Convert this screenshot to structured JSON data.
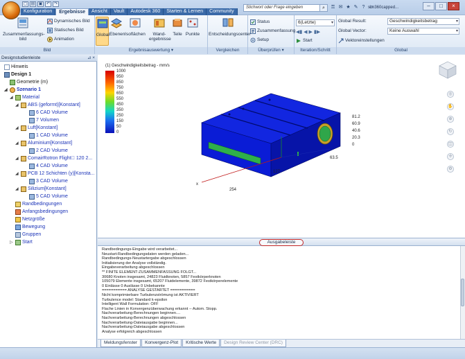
{
  "app": {
    "search_placeholder": "Stichwort oder Frage eingeben",
    "user_name": "sim360capped..."
  },
  "tabs": [
    "Konfiguration",
    "Ergebnisse",
    "Ansicht",
    "Vault",
    "Autodesk 360",
    "Starten & Lernen",
    "Community"
  ],
  "ribbon": {
    "bild": {
      "label": "Bild",
      "zusammenfassung": "Zusammenfassungs-bild",
      "dynamisch": "Dynamisches Bild",
      "statisch": "Statisches Bild",
      "animation": "Animation"
    },
    "auswertung": {
      "label": "Ergebnisauswertung",
      "global": "Global",
      "ebenen": "Ebenen",
      "isoflaechen": "Isoflächen",
      "wand": "Wand-ergebnisse",
      "teile": "Teile",
      "punkte": "Punkte"
    },
    "vergleichen": {
      "label": "Vergleichen",
      "entscheidung": "Entscheidungscenter"
    },
    "ueberpruefen": {
      "label": "Überprüfen",
      "status": "Status",
      "zusammenfassung": "Zusammenfassung",
      "setup": "Setup"
    },
    "iteration": {
      "label": "Iteration/Schritt",
      "value": "6(Letzte)",
      "start": "Start"
    },
    "global": {
      "label": "Global",
      "result_label": "Global Result:",
      "result_value": "Geschwindigkeitsbetrag",
      "vector_label": "Global Vector:",
      "vector_value": "Keine Auswahl",
      "vektor_settings": "Vektoreinstellungen"
    }
  },
  "left_panel": {
    "title": "Designstudienleiste",
    "items": [
      {
        "label": "Hinweis",
        "style": "normal"
      },
      {
        "label": "Design 1",
        "style": "bold"
      },
      {
        "label": "Geometrie (m)",
        "style": "normal"
      },
      {
        "label": "Szenario 1",
        "style": "bold-blue"
      },
      {
        "label": "Material",
        "style": "blue"
      },
      {
        "label": "ABS (geformt)[Konstant]",
        "style": "blue"
      },
      {
        "label": "6 CAD Volume",
        "style": "blue"
      },
      {
        "label": "7 Volumen",
        "style": "blue"
      },
      {
        "label": "Luft[Konstant]",
        "style": "blue"
      },
      {
        "label": "1 CAD Volume",
        "style": "blue"
      },
      {
        "label": "Aluminium[Konstant]",
        "style": "blue"
      },
      {
        "label": "2 CAD Volume",
        "style": "blue"
      },
      {
        "label": "ComairRotron Flight\u0000 120 2...",
        "style": "blue"
      },
      {
        "label": "4 CAD Volume",
        "style": "blue"
      },
      {
        "label": "PCB 12 Schichten (y)[Konsta...",
        "style": "blue"
      },
      {
        "label": "3 CAD Volume",
        "style": "blue"
      },
      {
        "label": "Silizium[Konstant]",
        "style": "blue"
      },
      {
        "label": "5 CAD Volume",
        "style": "blue"
      },
      {
        "label": "Randbedingungen",
        "style": "blue"
      },
      {
        "label": "Anfangsbedingungen",
        "style": "blue"
      },
      {
        "label": "Netzgröße",
        "style": "blue"
      },
      {
        "label": "Bewegung",
        "style": "blue"
      },
      {
        "label": "Gruppen",
        "style": "blue"
      },
      {
        "label": "Start",
        "style": "blue"
      }
    ]
  },
  "viewport": {
    "legend_title": "(1) Geschwindigkeitsbetrag - mm/s",
    "legend_values": [
      "1000",
      "950",
      "850",
      "750",
      "650",
      "550",
      "450",
      "350",
      "250",
      "150",
      "50",
      "0"
    ],
    "scale_values": [
      "81.2",
      "60.9",
      "40.6",
      "20.3",
      "0"
    ],
    "dim_labels": {
      "depth": "63.5",
      "width": "127",
      "length": "254"
    },
    "colors": {
      "model_blue": "#0a1cd6",
      "model_top": "#1429e0",
      "model_dark": "#0714a8",
      "green": "#2fb04a"
    }
  },
  "output": {
    "header": "Ausgabeleiste",
    "lines": [
      "Randbedingungs-Eingabe wird verarbeitet...",
      "Neustart-Randbedingungsdaten werden geladen...",
      "Randbedingungs-Neustartergabe abgeschlossen",
      "Initialisierung der Analyse vollständig.",
      "Eingabeverarbeitung abgeschlossen",
      "** FINITE ELEMENT-ZUSAMMENFASSUNG FOLGT...",
      "30680 Knoten insgesamt,    24823 Fluidknoten,    5857 Festkörperknoten",
      "105079 Elemente insgesamt,   65207 Fluidelemente,   39872 Festkörperelemente",
      "0 Einlässe    0 Auslässe    0 Unbekannte",
      "=========== ANALYSE GESTARTET ===========",
      "Nicht komprimierbare Turbulenzströmung ist AKTIVIERT",
      "Turbulence model: Standard k-epsilon",
      "Intelligent Wall Formulation: OFF",
      "Flache Linien in Konvergenzüberwachung erkannt -- Autom. Stopp.",
      "Nachverarbeitung-Berechnungen beginnen....",
      "Nachverarbeitung-Berechnungen abgeschlossen",
      "Nachverarbeitung-Dateiausgabe beginnen...",
      "Nachverarbeitung-Dateiausgabe abgeschlossen",
      "Analyse erfolgreich abgeschlossen"
    ],
    "tabs": [
      "Meldungsfenster",
      "Konvergenz-Plot",
      "Kritische Werte",
      "Design Review Center (DRC)"
    ]
  }
}
